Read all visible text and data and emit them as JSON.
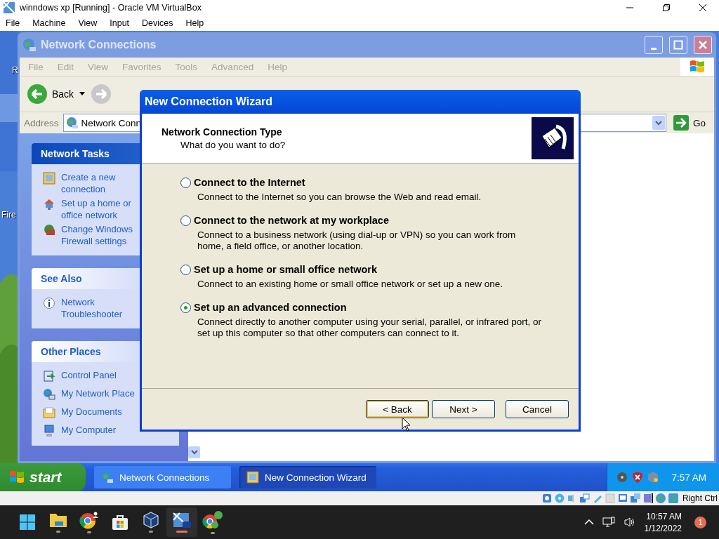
{
  "host_window": {
    "title": "winndows xp [Running] - Oracle VM VirtualBox"
  },
  "host_menu": [
    "File",
    "Machine",
    "View",
    "Input",
    "Devices",
    "Help"
  ],
  "desktop": {
    "icon_labels": [
      "R",
      "Fire"
    ]
  },
  "explorer": {
    "title": "Network Connections",
    "menu": [
      "File",
      "Edit",
      "View",
      "Favorites",
      "Tools",
      "Advanced",
      "Help"
    ],
    "toolbar": {
      "back": "Back"
    },
    "address": {
      "label": "Address",
      "value": "Network Conn",
      "go": "Go"
    },
    "panels": [
      {
        "title": "Network Tasks",
        "kind": "primary",
        "items": [
          {
            "label": "Create a new connection",
            "kind": "wizard"
          },
          {
            "label": "Set up a home or",
            "kind": "home_network",
            "second_line": "office network"
          },
          {
            "label": "Change Windows Firewall settings",
            "kind": "firewall"
          }
        ]
      },
      {
        "title": "See Also",
        "kind": "normal",
        "items": [
          {
            "label": "Network Troubleshooter",
            "kind": "info"
          }
        ]
      },
      {
        "title": "Other Places",
        "kind": "normal",
        "items": [
          {
            "label": "Control Panel",
            "kind": "control_panel"
          },
          {
            "label": "My Network Place",
            "kind": "network_places"
          },
          {
            "label": "My Documents",
            "kind": "documents"
          },
          {
            "label": "My Computer",
            "kind": "computer"
          }
        ]
      }
    ]
  },
  "wizard": {
    "title": "New Connection Wizard",
    "header": {
      "title": "Network Connection Type",
      "subtitle": "What do you want to do?"
    },
    "options": [
      {
        "label": "Connect to the Internet",
        "description": "Connect to the Internet so you can browse the Web and read email.",
        "selected": false
      },
      {
        "label": "Connect to the network at my workplace",
        "description": "Connect to a business network (using dial-up or VPN) so you can work from home, a field office, or another location.",
        "selected": false
      },
      {
        "label": "Set up a home or small office network",
        "description": "Connect to an existing home or small office network or set up a new one.",
        "selected": false
      },
      {
        "label": "Set up an advanced connection",
        "description": "Connect directly to another computer using your serial, parallel, or infrared port, or set up this computer so that other computers can connect to it.",
        "selected": true
      }
    ],
    "buttons": [
      {
        "label": "< Back",
        "focused": true
      },
      {
        "label": "Next >",
        "focused": false
      },
      {
        "label": "Cancel",
        "focused": false
      }
    ]
  },
  "xp_taskbar": {
    "start": "start",
    "tasks": [
      {
        "label": "Network Connections",
        "kind": "network",
        "selected": false
      },
      {
        "label": "New Connection Wizard",
        "kind": "wizard",
        "selected": true
      }
    ],
    "clock": "7:57 AM"
  },
  "vbox_status": {
    "host_key": "Right Ctrl"
  },
  "host_taskbar": {
    "apps": [
      {
        "kind": "start",
        "running": false,
        "selected": false
      },
      {
        "kind": "folder",
        "running": true,
        "selected": false
      },
      {
        "kind": "chrome_profile",
        "running": true,
        "selected": false
      },
      {
        "kind": "store",
        "running": false,
        "selected": false
      },
      {
        "kind": "virtualbox",
        "running": true,
        "selected": false
      },
      {
        "kind": "vm",
        "running": true,
        "selected": true
      },
      {
        "kind": "chrome_p",
        "running": true,
        "selected": false
      }
    ],
    "time": "10:57 AM",
    "date": "1/12/2022",
    "notifications": "1"
  }
}
